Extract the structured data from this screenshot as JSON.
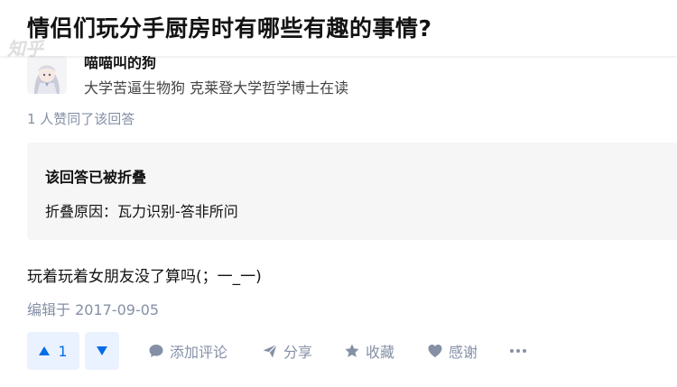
{
  "question": {
    "title": "情侣们玩分手厨房时有哪些有趣的事情?"
  },
  "watermark": {
    "text": "知乎"
  },
  "author": {
    "name": "喵喵叫的狗",
    "headline": "大学苦逼生物狗 克莱登大学哲学博士在读",
    "avatar_icon": "anime-girl-avatar"
  },
  "answer": {
    "vote_summary": "1 人赞同了该回答",
    "collapsed": {
      "title": "该回答已被折叠",
      "reason": "折叠原因：瓦力识别-答非所问"
    },
    "content": "玩着玩着女朋友没了算吗(；一_一)",
    "edit_time": "编辑于 2017-09-05"
  },
  "actions": {
    "upvote_count": "1",
    "upvote_icon": "triangle-up-icon",
    "downvote_icon": "triangle-down-icon",
    "comment": {
      "label": "添加评论",
      "icon": "comment-icon"
    },
    "share": {
      "label": "分享",
      "icon": "share-icon"
    },
    "favorite": {
      "label": "收藏",
      "icon": "star-icon"
    },
    "thanks": {
      "label": "感谢",
      "icon": "heart-icon"
    },
    "more_icon": "more-icon"
  },
  "colors": {
    "accent": "#056de8",
    "accent_bg": "#ebf2ff",
    "muted": "#8590a6",
    "collapsed_bg": "#f6f6f6"
  }
}
